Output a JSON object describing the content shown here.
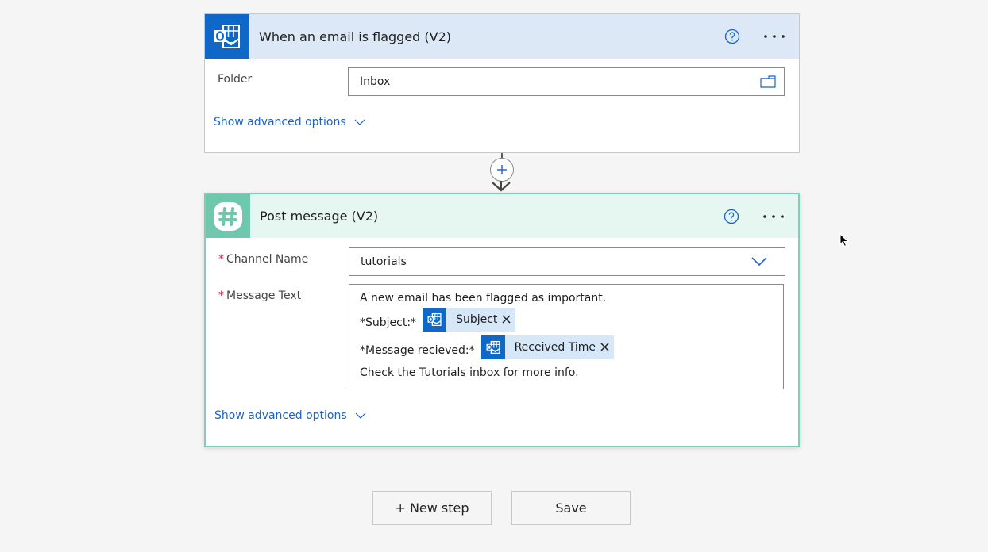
{
  "trigger": {
    "title": "When an email is flagged (V2)",
    "icon": "outlook-icon",
    "accent_color": "#0f67c7",
    "header_bg": "#dce8f6",
    "fields": [
      {
        "label": "Folder",
        "required": false,
        "value": "Inbox",
        "trailing_icon": "folder-icon"
      }
    ],
    "advanced_label": "Show advanced options"
  },
  "connector": {
    "add_icon": "plus-icon",
    "arrow_icon": "arrow-down-icon"
  },
  "action": {
    "title": "Post message (V2)",
    "icon": "slack-icon",
    "accent_color": "#6fc8ab",
    "header_bg": "#e6f7f2",
    "channel": {
      "label": "Channel Name",
      "required_mark": "*",
      "value": "tutorials",
      "trailing_icon": "chevron-down-icon"
    },
    "message": {
      "label": "Message Text",
      "required_mark": "*",
      "line1": "A new email has been flagged as important.",
      "line2_prefix": "*Subject:*",
      "token1": "Subject",
      "line3_prefix": "*Message recieved:*",
      "token2": "Received Time",
      "line4": "Check the Tutorials inbox for more info."
    },
    "advanced_label": "Show advanced options"
  },
  "footer": {
    "new_step_label": "+ New step",
    "save_label": "Save"
  }
}
